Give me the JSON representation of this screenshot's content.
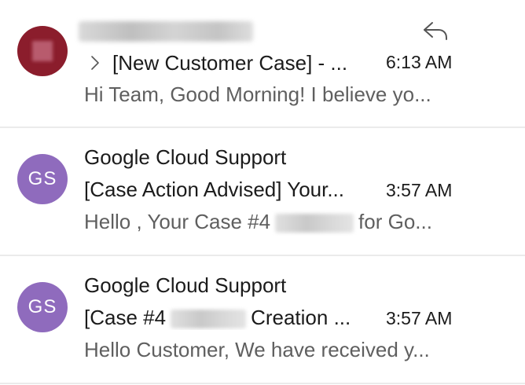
{
  "messages": [
    {
      "sender": "",
      "sender_redacted": true,
      "avatar": "profile-photo",
      "subject": "[New Customer Case] - ...",
      "time": "6:13 AM",
      "preview": "Hi Team, Good Morning! I believe yo...",
      "has_reply_indicator": true,
      "has_thread_chevron": true
    },
    {
      "sender": "Google Cloud Support",
      "avatar_initials": "GS",
      "avatar_color": "#8f6bbd",
      "subject": "[Case Action Advised] Your...",
      "time": "3:57 AM",
      "preview_before": "Hello , Your Case #4",
      "preview_after": "for Go..."
    },
    {
      "sender": "Google Cloud Support",
      "avatar_initials": "GS",
      "avatar_color": "#8f6bbd",
      "subject_before": "[Case #4",
      "subject_after": "Creation ...",
      "time": "3:57 AM",
      "preview": "Hello Customer, We have received y..."
    }
  ],
  "icons": {
    "reply": "reply-arrow-icon",
    "chevron": "chevron-right-icon"
  },
  "colors": {
    "avatar_gs": "#8f6bbd",
    "avatar_photo": "#8b1d2c",
    "separator": "#ebebeb",
    "preview_text": "#5f5f5f"
  }
}
